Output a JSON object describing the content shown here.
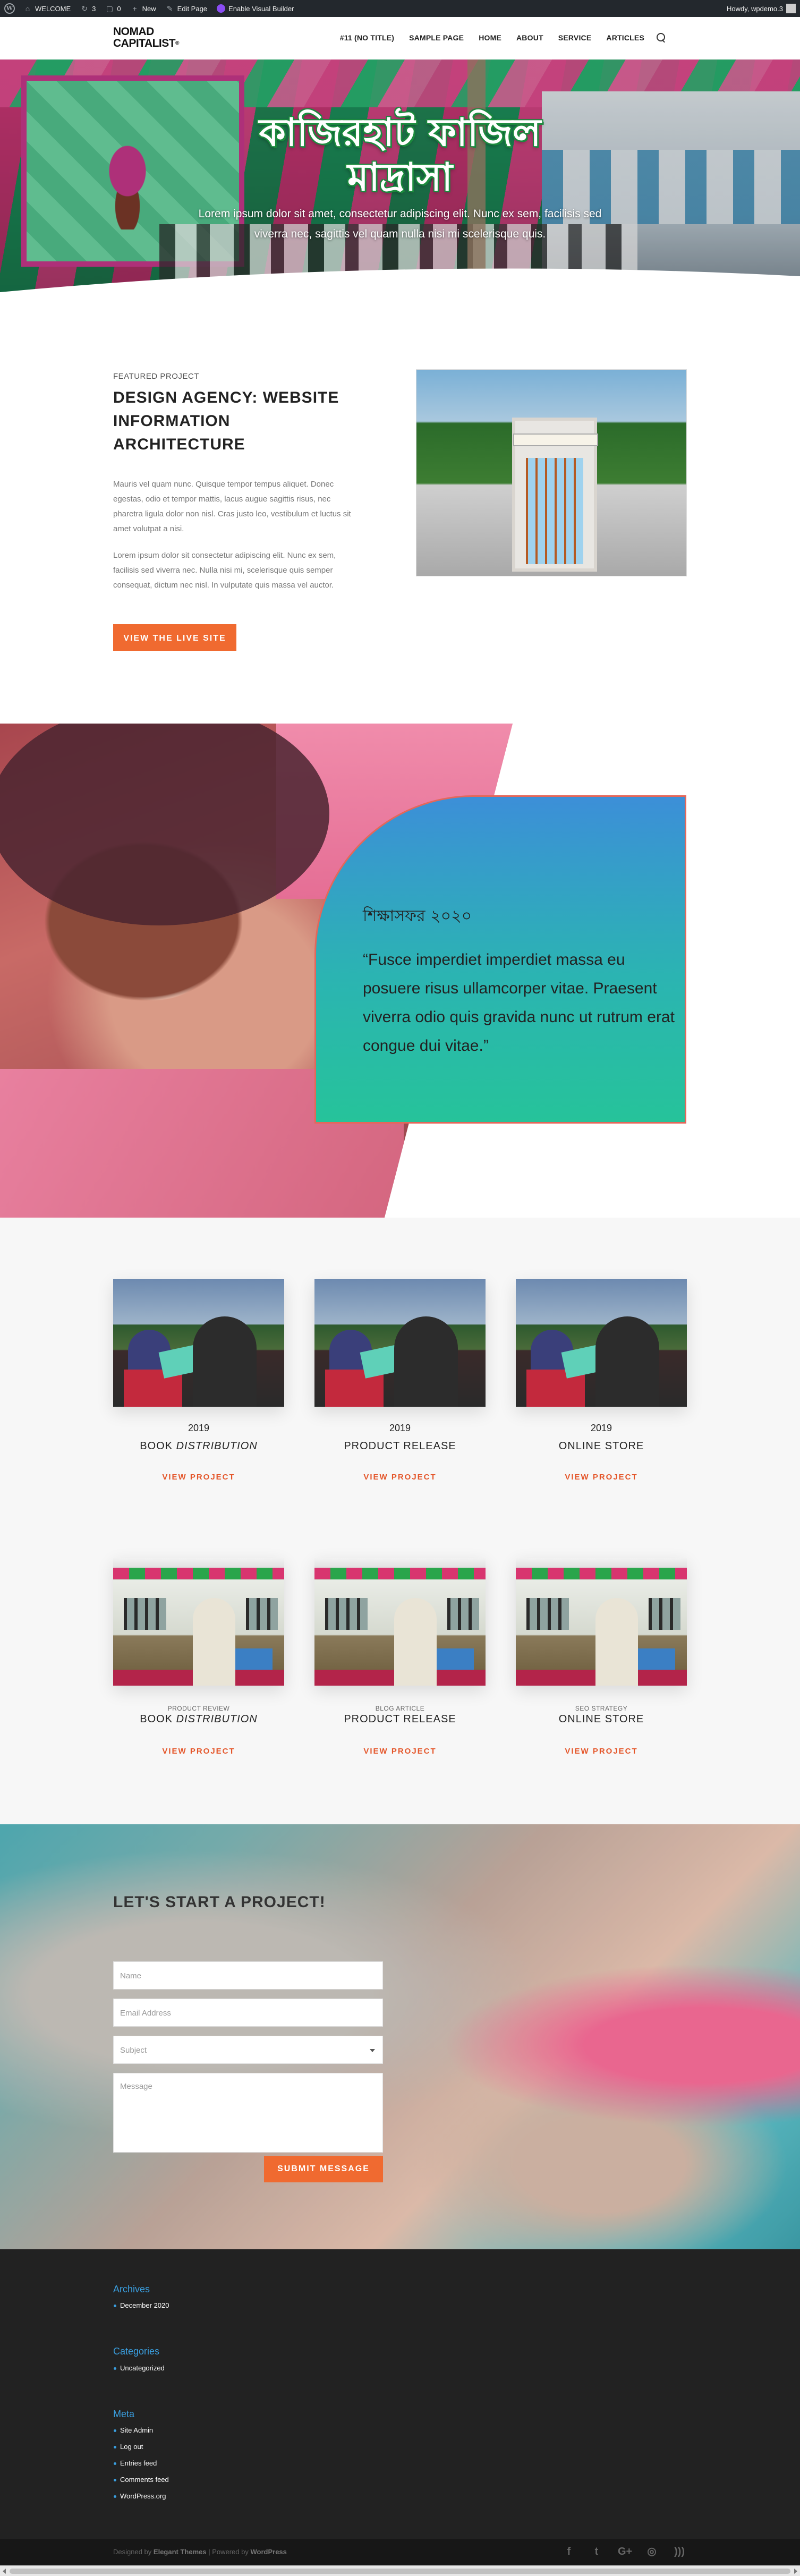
{
  "adminbar": {
    "items": [
      "WELCOME",
      "3",
      "0",
      "New",
      "Edit Page",
      "Enable Visual Builder"
    ],
    "user": "Howdy, wpdemo.3"
  },
  "header": {
    "logo_line1": "NOMAD",
    "logo_line2": "CAPITALIST",
    "nav": [
      "#11 (NO TITLE)",
      "SAMPLE PAGE",
      "HOME",
      "ABOUT",
      "SERVICE",
      "ARTICLES"
    ]
  },
  "hero": {
    "title_line1": "কাজিরহাট ফাজিল",
    "title_line2": "মাদ্রাসা",
    "subtitle": "Lorem ipsum dolor sit amet, consectetur adipiscing elit. Nunc ex sem, facilisis sed viverra nec, sagittis vel quam nulla nisi mi scelerisque quis."
  },
  "featured": {
    "label": "FEATURED PROJECT",
    "title": "DESIGN AGENCY: WEBSITE INFORMATION ARCHITECTURE",
    "para1": "Mauris vel quam nunc. Quisque tempor tempus aliquet. Donec egestas, odio et tempor mattis, lacus augue sagittis risus, nec pharetra ligula dolor non nisl. Cras justo leo, vestibulum et luctus sit amet volutpat a nisi.",
    "para2": "Lorem ipsum dolor sit consectetur adipiscing elit. Nunc ex sem, facilisis sed viverra nec. Nulla nisi mi, scelerisque quis semper consequat, dictum nec nisl. In vulputate quis massa vel auctor.",
    "button": "VIEW THE LIVE SITE"
  },
  "quote": {
    "name": "শিক্ষাসফর ২০২০",
    "text": "“Fusce imperdiet imperdiet massa eu posuere risus ullamcorper vitae. Praesent viverra odio quis gravida nunc ut rutrum erat congue dui vitae.”"
  },
  "projects_row1": [
    {
      "year": "2019",
      "name_plain": "BOOK ",
      "name_em": "DISTRIBUTION",
      "link": "VIEW PROJECT"
    },
    {
      "year": "2019",
      "name_plain": "PRODUCT RELEASE",
      "name_em": "",
      "link": "VIEW PROJECT"
    },
    {
      "year": "2019",
      "name_plain": "ONLINE STORE",
      "name_em": "",
      "link": "VIEW PROJECT"
    }
  ],
  "projects_row2": [
    {
      "cat": "PRODUCT REVIEW",
      "name_plain": "BOOK ",
      "name_em": "DISTRIBUTION",
      "link": "VIEW PROJECT"
    },
    {
      "cat": "BLOG ARTICLE",
      "name_plain": "PRODUCT RELEASE",
      "name_em": "",
      "link": "VIEW PROJECT"
    },
    {
      "cat": "SEO STRATEGY",
      "name_plain": "ONLINE STORE",
      "name_em": "",
      "link": "VIEW PROJECT"
    }
  ],
  "contact": {
    "title": "LET'S START A PROJECT!",
    "name_placeholder": "Name",
    "email_placeholder": "Email Address",
    "subject_placeholder": "Subject",
    "message_placeholder": "Message",
    "submit": "SUBMIT MESSAGE"
  },
  "footer": {
    "archives_title": "Archives",
    "archives": [
      "December 2020"
    ],
    "categories_title": "Categories",
    "categories": [
      "Uncategorized"
    ],
    "meta_title": "Meta",
    "meta": [
      "Site Admin",
      "Log out",
      "Entries feed",
      "Comments feed",
      "WordPress.org"
    ],
    "credits_prefix": "Designed by",
    "credits_et": "Elegant Themes",
    "credits_mid": " | Powered by ",
    "credits_wp": "WordPress"
  },
  "colors": {
    "accent": "#f06a30",
    "link": "#e4562a",
    "footer_title": "#3a9fe0",
    "adminbar": "#23282d"
  }
}
